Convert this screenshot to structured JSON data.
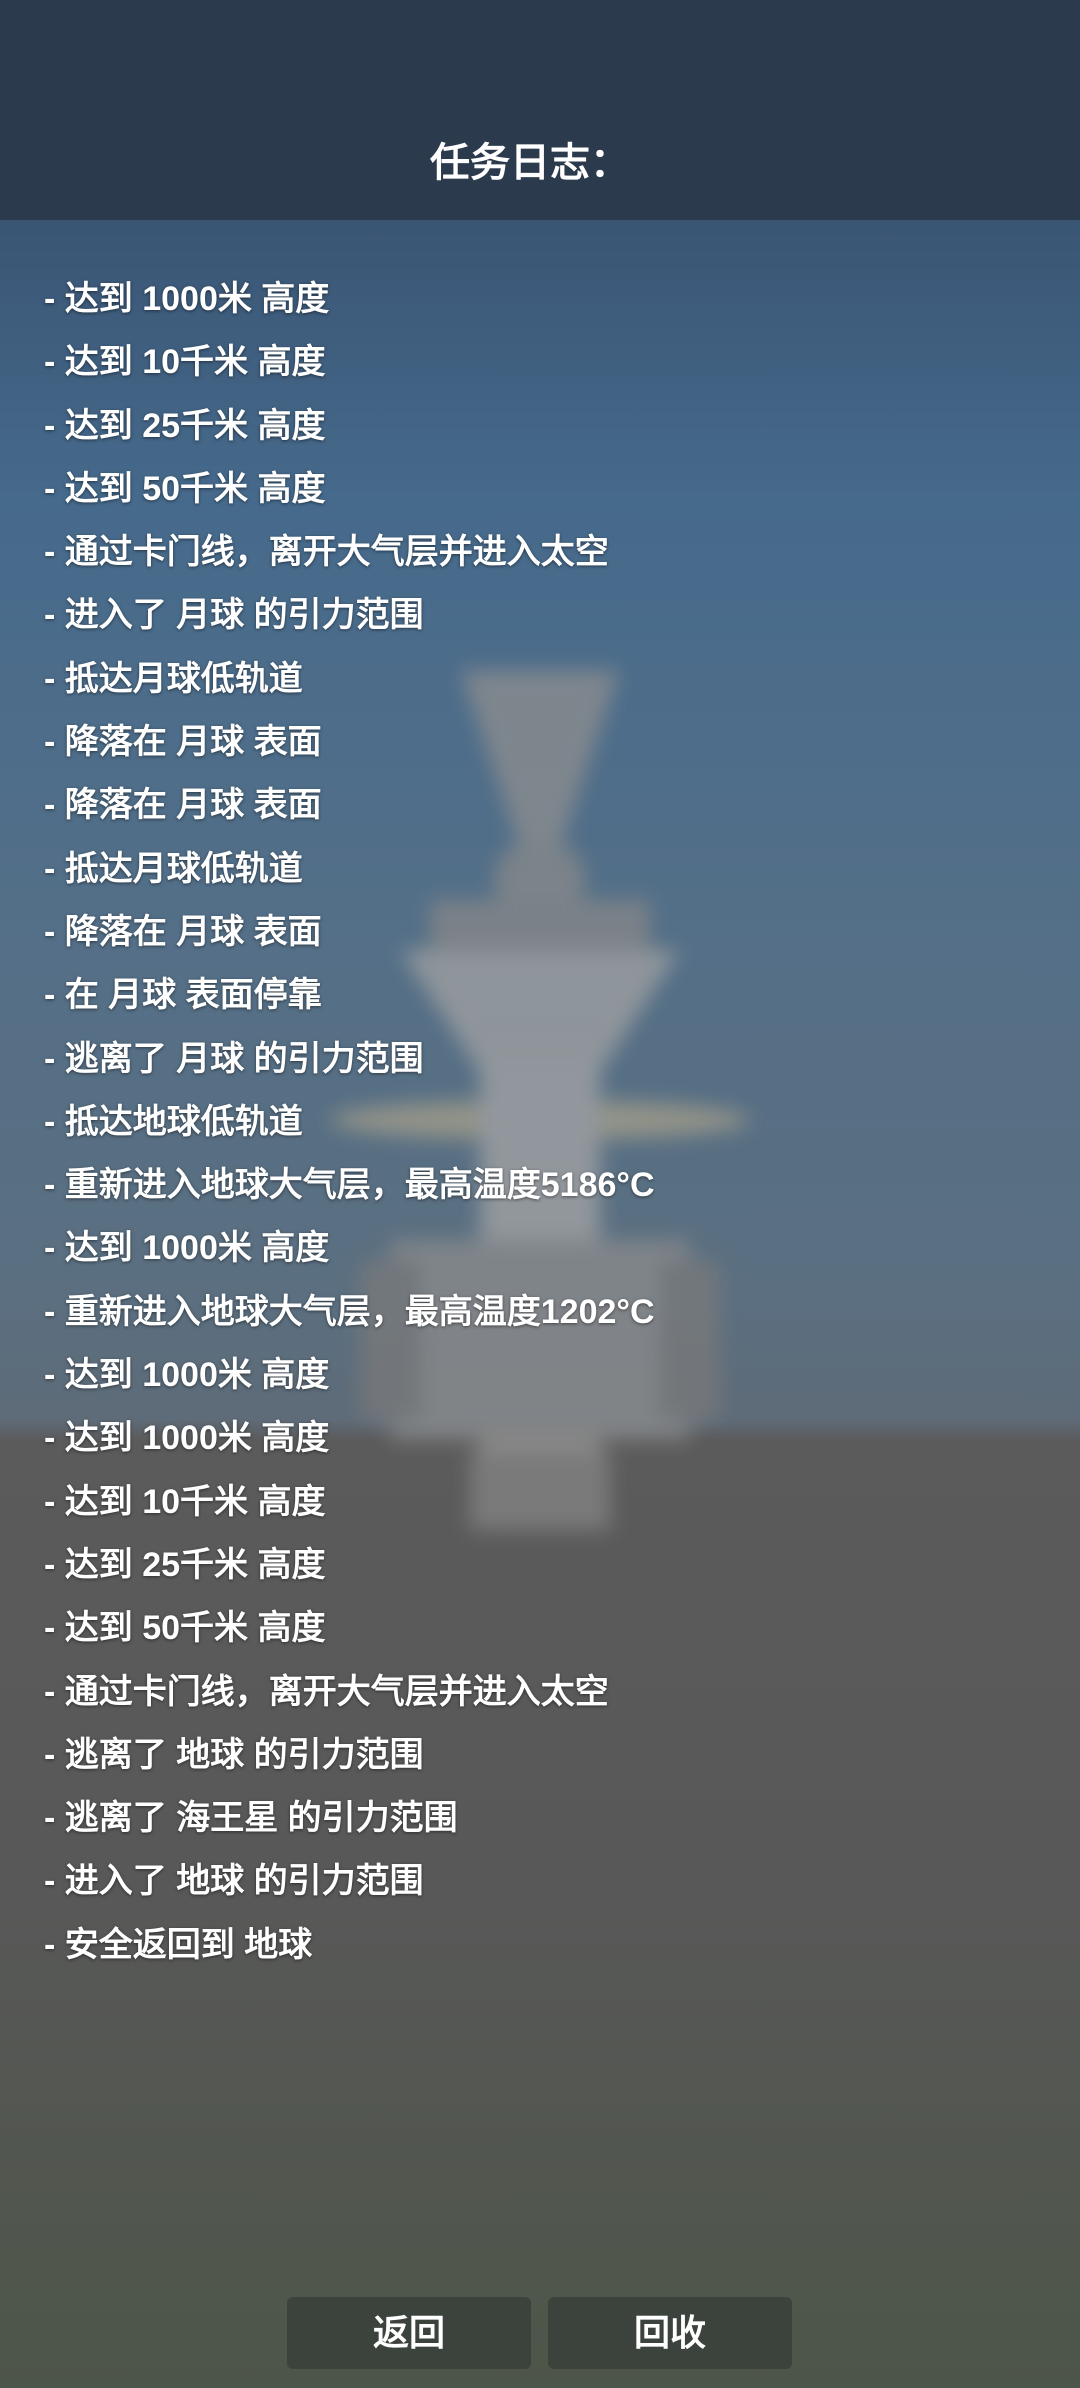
{
  "header": {
    "title": "任务日志："
  },
  "log_items": [
    "- 达到 1000米 高度",
    "- 达到 10千米 高度",
    "- 达到 25千米 高度",
    "- 达到 50千米 高度",
    "- 通过卡门线，离开大气层并进入太空",
    "- 进入了 月球 的引力范围",
    "- 抵达月球低轨道",
    "- 降落在 月球 表面",
    "- 降落在 月球 表面",
    "- 抵达月球低轨道",
    "- 降落在 月球 表面",
    "- 在 月球 表面停靠",
    "- 逃离了 月球 的引力范围",
    "- 抵达地球低轨道",
    "- 重新进入地球大气层，最高温度5186°C",
    "- 达到 1000米 高度",
    "- 重新进入地球大气层，最高温度1202°C",
    "- 达到 1000米 高度",
    "- 达到 1000米 高度",
    "- 达到 10千米 高度",
    "- 达到 25千米 高度",
    "- 达到 50千米 高度",
    "- 通过卡门线，离开大气层并进入太空",
    "- 逃离了 地球 的引力范围",
    "- 逃离了 海王星 的引力范围",
    "- 进入了 地球 的引力范围",
    "- 安全返回到 地球"
  ],
  "buttons": {
    "back": "返回",
    "recover": "回收"
  },
  "colors": {
    "header_bg": "#2b3a4c",
    "button_bg": "#3c433c",
    "text": "#ffffff"
  }
}
